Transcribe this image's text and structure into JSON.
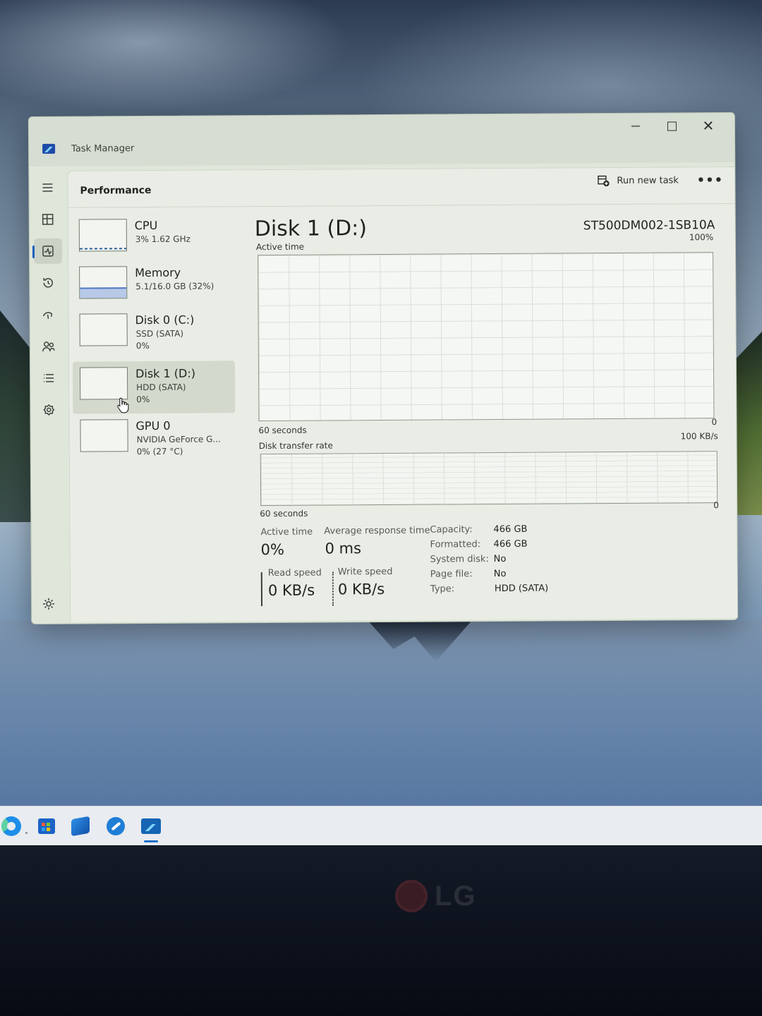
{
  "window": {
    "title": "Task Manager"
  },
  "header": {
    "page_title": "Performance",
    "run_new_task": "Run new task",
    "more": "•••"
  },
  "nav": {
    "icons": [
      "hamburger-icon",
      "processes-icon",
      "performance-icon",
      "app-history-icon",
      "startup-apps-icon",
      "users-icon",
      "details-icon",
      "services-icon",
      "settings-icon"
    ]
  },
  "devices": [
    {
      "name": "CPU",
      "line1": "3%  1.62 GHz",
      "line2": ""
    },
    {
      "name": "Memory",
      "line1": "5.1/16.0 GB (32%)",
      "line2": ""
    },
    {
      "name": "Disk 0 (C:)",
      "line1": "SSD (SATA)",
      "line2": "0%"
    },
    {
      "name": "Disk 1 (D:)",
      "line1": "HDD (SATA)",
      "line2": "0%"
    },
    {
      "name": "GPU 0",
      "line1": "NVIDIA GeForce G...",
      "line2": "0%  (27 °C)"
    }
  ],
  "disk": {
    "title": "Disk 1 (D:)",
    "model": "ST500DM002-1SB10A",
    "active_time_graph": {
      "label": "Active time",
      "max": "100%",
      "time_span": "60 seconds",
      "min": "0"
    },
    "transfer_graph": {
      "label": "Disk transfer rate",
      "max": "100 KB/s",
      "time_span": "60 seconds",
      "min": "0"
    },
    "stats": {
      "active_time_label": "Active time",
      "active_time_value": "0%",
      "avg_response_label": "Average response time",
      "avg_response_value": "0 ms",
      "read_speed_label": "Read speed",
      "read_speed_value": "0 KB/s",
      "write_speed_label": "Write speed",
      "write_speed_value": "0 KB/s"
    },
    "properties": {
      "capacity_label": "Capacity:",
      "capacity_value": "466 GB",
      "formatted_label": "Formatted:",
      "formatted_value": "466 GB",
      "system_disk_label": "System disk:",
      "system_disk_value": "No",
      "page_file_label": "Page file:",
      "page_file_value": "No",
      "type_label": "Type:",
      "type_value": "HDD (SATA)"
    }
  },
  "taskbar": {
    "icons": [
      "edge-icon",
      "microsoft-store-icon",
      "outlook-icon",
      "vscode-icon",
      "task-manager-icon"
    ]
  },
  "monitor": {
    "brand": "LG"
  },
  "colors": {
    "selection": "#d3dacd",
    "accent": "#1b5fbe",
    "memory_fill": "#4e79c4"
  }
}
